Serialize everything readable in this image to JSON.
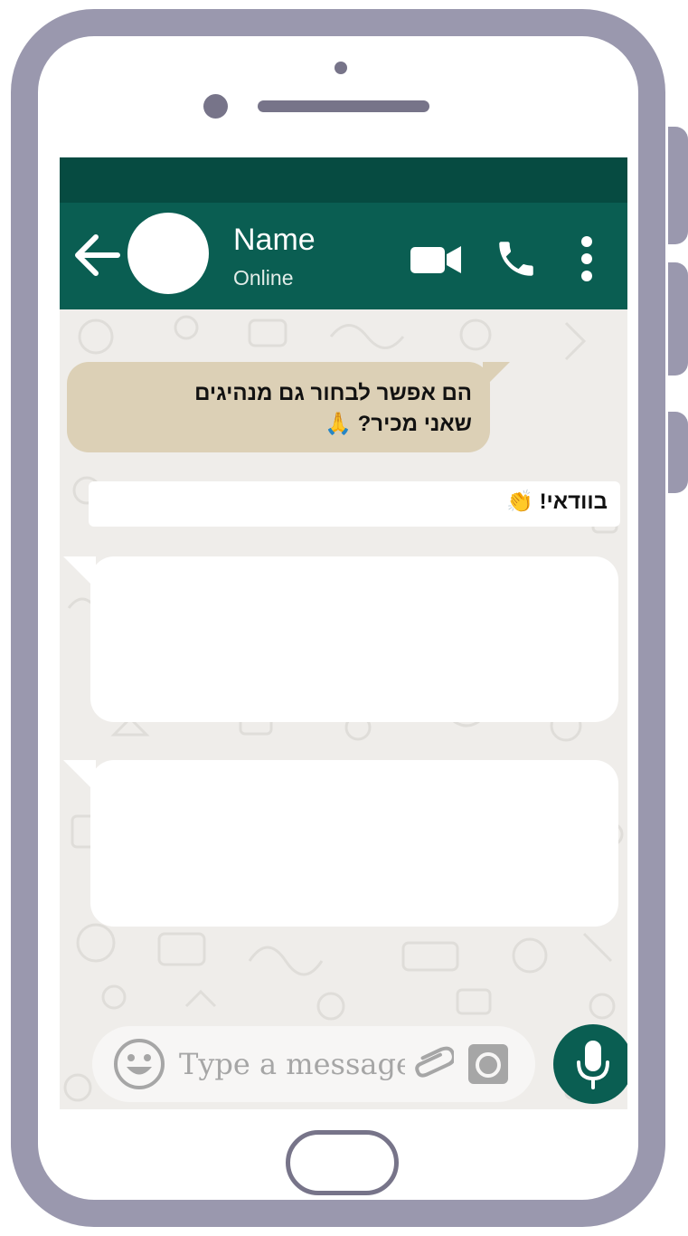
{
  "header": {
    "contact_name": "Name",
    "contact_status": "Online"
  },
  "icons": {
    "back": "arrow-left-icon",
    "video": "video-camera-icon",
    "call": "phone-icon",
    "more": "more-vertical-icon",
    "emoji": "emoji-icon",
    "attach": "paperclip-icon",
    "camera": "camera-icon",
    "mic": "microphone-icon"
  },
  "messages": [
    {
      "direction": "outgoing",
      "lines": [
        "הם אפשר לבחור גם מנהיגים",
        "שאני מכיר? 🙏"
      ]
    },
    {
      "direction": "incoming",
      "text": "בוודאי! 👏"
    },
    {
      "direction": "incoming",
      "text": ""
    },
    {
      "direction": "incoming",
      "text": ""
    }
  ],
  "composer": {
    "placeholder": "Type a message"
  },
  "colors": {
    "header": "#0a5e52",
    "statusbar": "#064b41",
    "outgoing_bubble": "#dcd0b6",
    "phone_frame": "#9a98ae"
  }
}
